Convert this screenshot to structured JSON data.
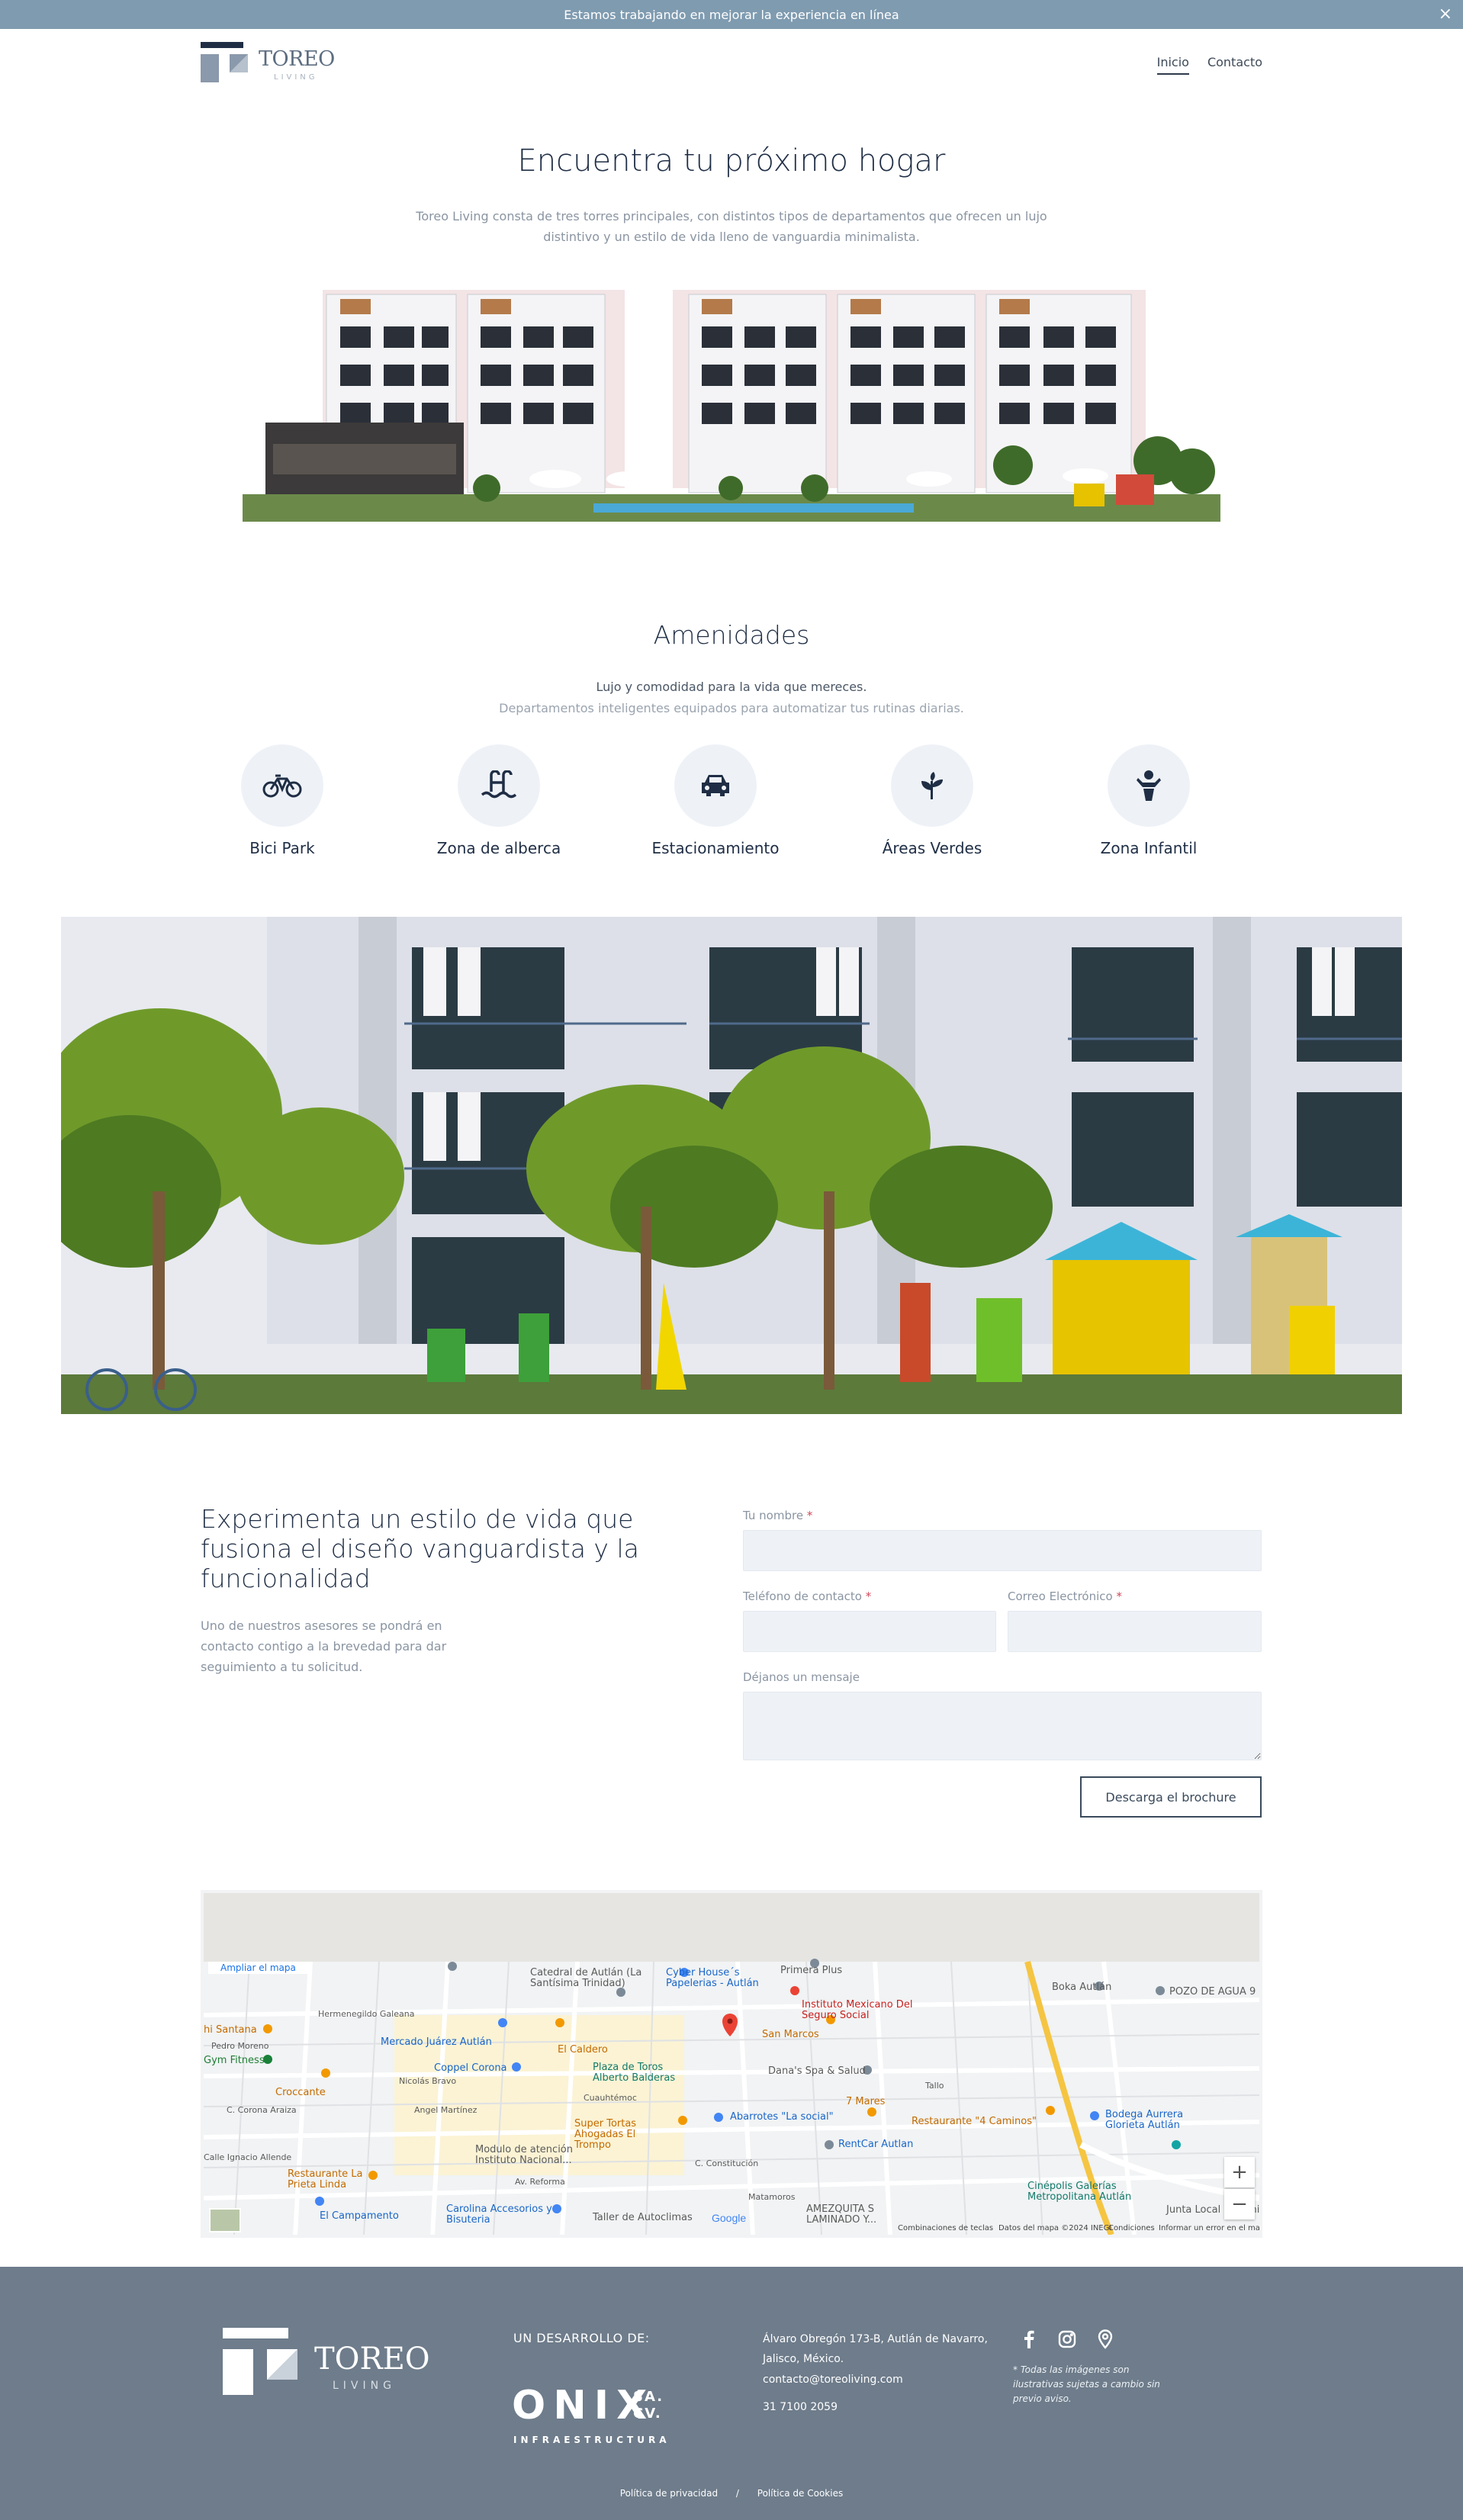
{
  "banner": {
    "text": "Estamos trabajando en mejorar la experiencia en línea",
    "close": "×"
  },
  "header": {
    "logo_text": "TOREO",
    "logo_sub": "LIVING",
    "nav": [
      {
        "label": "Inicio",
        "active": true
      },
      {
        "label": "Contacto",
        "active": false
      }
    ]
  },
  "hero": {
    "title": "Encuentra tu próximo hogar",
    "description": "Toreo Living consta de tres torres principales, con distintos tipos de departamentos que ofrecen un lujo distintivo y un estilo de vida lleno de vanguardia minimalista."
  },
  "amenities": {
    "title": "Amenidades",
    "subtitle1": "Lujo y comodidad para la vida que mereces.",
    "subtitle2": "Departamentos inteligentes equipados para automatizar tus rutinas diarias.",
    "items": [
      {
        "label": "Bici Park",
        "icon": "bicycle-icon"
      },
      {
        "label": "Zona de alberca",
        "icon": "pool-icon"
      },
      {
        "label": "Estacionamiento",
        "icon": "car-icon"
      },
      {
        "label": "Áreas Verdes",
        "icon": "plant-icon"
      },
      {
        "label": "Zona Infantil",
        "icon": "child-icon"
      }
    ]
  },
  "contact": {
    "title": "Experimenta un estilo de vida que fusiona el diseño vanguardista y la funcionalidad",
    "description": "Uno de nuestros asesores se pondrá en contacto contigo a la brevedad para dar seguimiento a tu solicitud.",
    "form": {
      "name_label": "Tu nombre",
      "phone_label": "Teléfono de contacto",
      "email_label": "Correo Electrónico",
      "message_label": "Déjanos un mensaje",
      "required_mark": "*",
      "submit": "Descarga el brochure"
    }
  },
  "map": {
    "enlarge": "Ampliar el mapa",
    "labels": [
      "Catedral de Autlán (La Santísima Trinidad)",
      "Cyber House´s Papelerias - Autlán",
      "Primera Plus",
      "Boka Autlán",
      "POZO DE AGUA 9",
      "Instituto Mexicano Del Seguro Social",
      "San Marcos",
      "Mercado Juárez Autlán",
      "El Caldero",
      "Coppel Corona",
      "Plaza de Toros Alberto Balderas",
      "Dana's Spa & Salud",
      "hi Santana",
      "Gym Fitness",
      "Croccante",
      "7 Mares",
      "Abarrotes \"La social\"",
      "Restaurante \"4 Caminos\"",
      "Bodega Aurrera Glorieta Autlán",
      "Super Tortas Ahogadas El Trompo",
      "RentCar Autlan",
      "Modulo de atención Instituto Nacional...",
      "Restaurante La Prieta Linda",
      "Cinépolis Galerías Metropolitana Autlán",
      "El Campamento",
      "Carolina Accesorios y Bisuteria",
      "Taller de Autoclimas",
      "AMEZQUITA S LAMINADO Y...",
      "Junta Local de sanic",
      "Hermenegildo Galeana",
      "Pedro Moreno",
      "C. Corona Araiza",
      "Calle Ignacio Allende",
      "Angel Martínez",
      "Cuauhtémoc",
      "C. Constitución",
      "Av. Reforma",
      "Matamoros",
      "Nicolás Bravo",
      "Tallo"
    ],
    "attribution": [
      "Google",
      "Combinaciones de teclas",
      "Datos del mapa ©2024 INEGI",
      "Condiciones",
      "Informar un error en el mapa"
    ],
    "zoom_in": "+",
    "zoom_out": "−"
  },
  "footer": {
    "logo_text": "TOREO",
    "logo_sub": "LIVING",
    "developer_label": "UN DESARROLLO DE:",
    "onix": "ONIX",
    "onix_sacv": "SA. CV.",
    "onix_sub": "INFRAESTRUCTURA",
    "address": "Álvaro Obregón 173-B, Autlán de Navarro, Jalisco, México.",
    "email": "contacto@toreoliving.com",
    "phone": "31 7100 2059",
    "note": "* Todas las imágenes son ilustrativas sujetas a cambio sin previo aviso.",
    "links": [
      "Política de privacidad",
      "/",
      "Política de Cookies"
    ]
  },
  "colors": {
    "banner": "#7f9bb0",
    "navy": "#1f2e45",
    "footer": "#6e7c8b",
    "field": "#eef2f7",
    "amenity_circle": "#eef2f7"
  }
}
